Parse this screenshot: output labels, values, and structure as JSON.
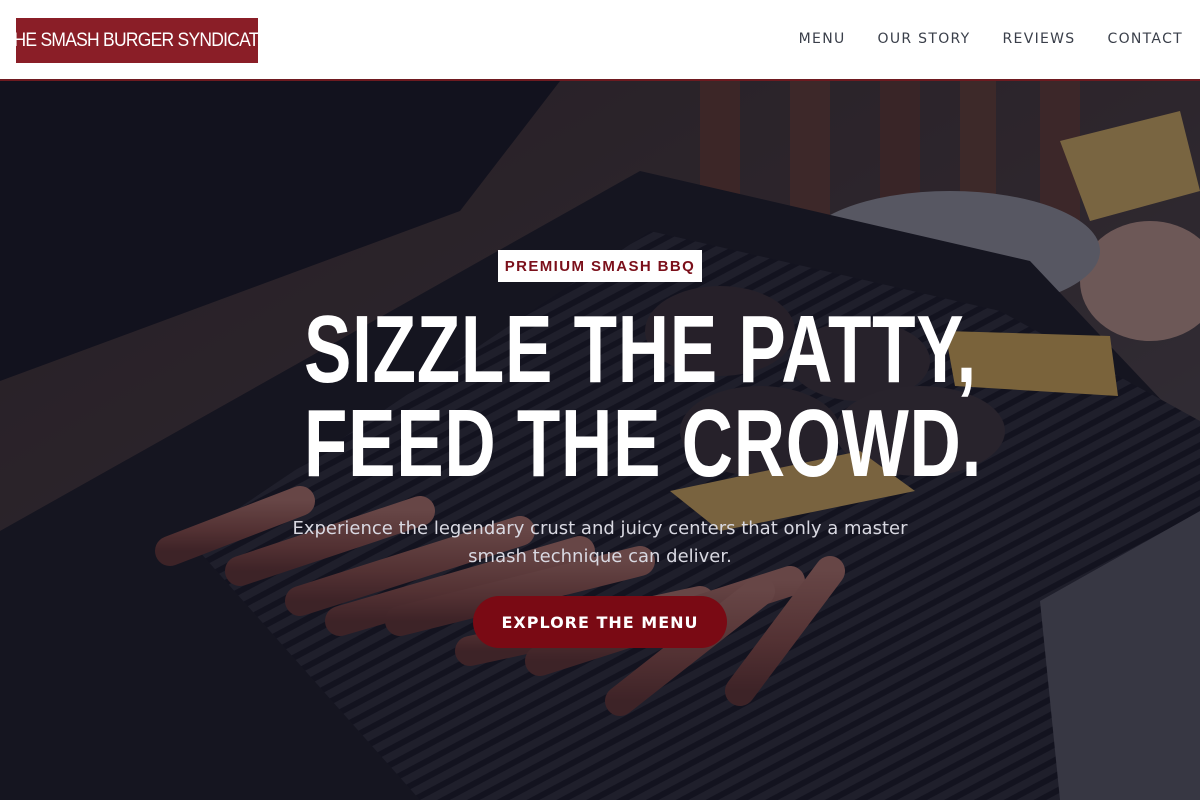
{
  "brand": {
    "name": "THE SMASH BURGER SYNDICATE",
    "color": "#8a1e27"
  },
  "nav": {
    "items": [
      "MENU",
      "OUR STORY",
      "REVIEWS",
      "CONTACT"
    ]
  },
  "hero": {
    "badge": "PREMIUM SMASH BBQ",
    "title_line1": "SIZZLE THE PATTY,",
    "title_line2": "FEED THE CROWD.",
    "subtitle": "Experience the legendary crust and juicy centers that only a master smash technique can deliver.",
    "cta_label": "EXPLORE THE MENU",
    "cta_color": "#7a0a14",
    "background_image": "grill with burger patties, cheese slices and hot dogs"
  }
}
